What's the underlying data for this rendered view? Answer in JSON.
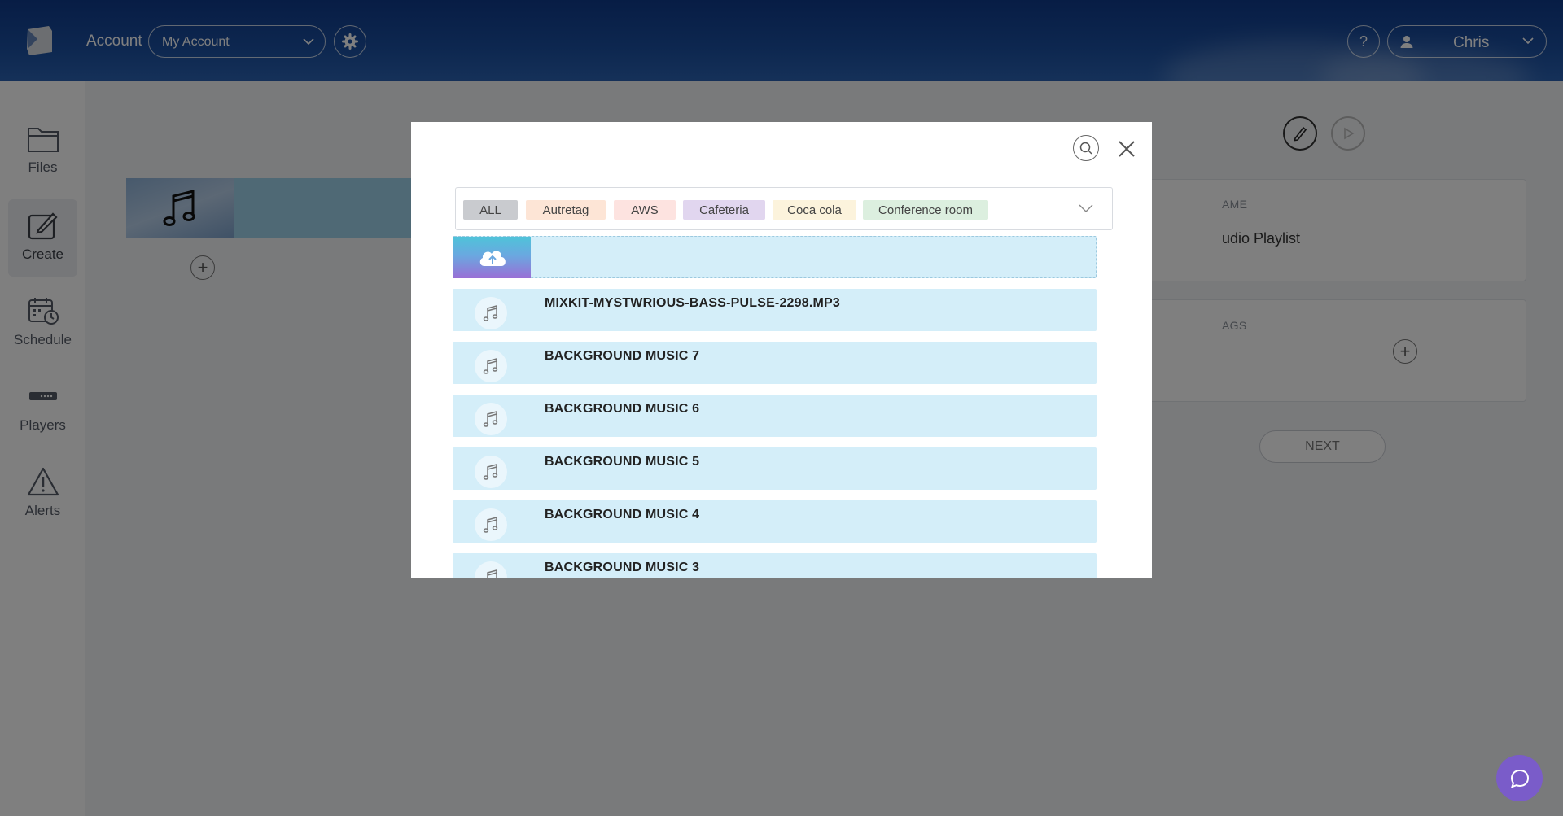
{
  "header": {
    "account_label": "Account",
    "account_select_value": "My Account",
    "help_label": "?",
    "user_name": "Chris"
  },
  "sidebar": {
    "items": [
      {
        "label": "Files",
        "icon": "folder-icon"
      },
      {
        "label": "Create",
        "icon": "edit-icon",
        "active": true
      },
      {
        "label": "Schedule",
        "icon": "calendar-clock-icon"
      },
      {
        "label": "Players",
        "icon": "player-device-icon"
      },
      {
        "label": "Alerts",
        "icon": "warning-icon"
      }
    ]
  },
  "main": {
    "name_card": {
      "label": "AME",
      "value": "udio Playlist"
    },
    "tags_card": {
      "label": "AGS"
    },
    "next_label": "NEXT"
  },
  "modal": {
    "tags": [
      {
        "label": "ALL",
        "color": "#c9cbcf"
      },
      {
        "label": "Autretag",
        "color": "#fde5d6"
      },
      {
        "label": "AWS",
        "color": "#fde3e0"
      },
      {
        "label": "Cafeteria",
        "color": "#e1d6ef"
      },
      {
        "label": "Coca cola",
        "color": "#fcf3dc"
      },
      {
        "label": "Conference room",
        "color": "#dcefdf"
      }
    ],
    "files": [
      {
        "name": "MIXKIT-MYSTWRIOUS-BASS-PULSE-2298.MP3"
      },
      {
        "name": "BACKGROUND MUSIC 7"
      },
      {
        "name": "BACKGROUND MUSIC 6"
      },
      {
        "name": "BACKGROUND MUSIC 5"
      },
      {
        "name": "BACKGROUND MUSIC 4"
      },
      {
        "name": "BACKGROUND MUSIC 3"
      }
    ]
  },
  "colors": {
    "header": "#1b4fa0",
    "file_row": "#d4eef9",
    "chat_bubble": "#7a5cc9"
  }
}
